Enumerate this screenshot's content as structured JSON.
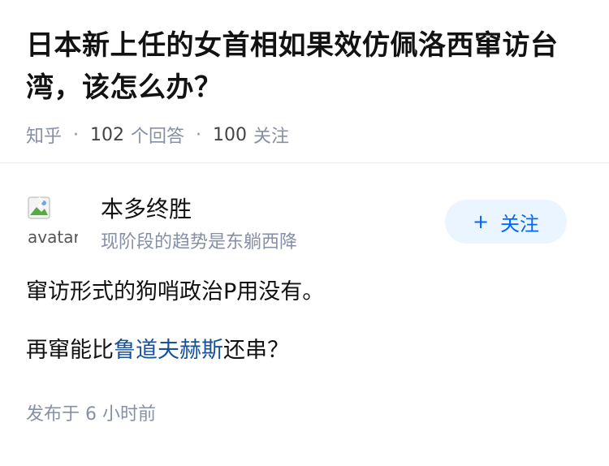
{
  "question": {
    "title": "日本新上任的女首相如果效仿佩洛西窜访台湾，该怎么办？",
    "source": "知乎",
    "separator": "·",
    "answer_count": "102",
    "answer_label": "个回答",
    "follower_count": "100",
    "follower_label": "关注"
  },
  "answer": {
    "avatar_alt": "avatar",
    "author_name": "本多终胜",
    "author_bio": "现阶段的趋势是东躺西降",
    "follow_button": {
      "icon": "plus-icon",
      "plus": "+",
      "label": "关注"
    },
    "paragraph1": "窜访形式的狗哨政治P用没有。",
    "paragraph2_before": "再窜能比",
    "paragraph2_link": "鲁道夫赫斯",
    "paragraph2_after": "还串？",
    "published": "发布于 6 小时前"
  },
  "colors": {
    "link": "#175199",
    "accent": "#0066ff",
    "follow_bg": "#ebf5ff",
    "meta": "#8590a6"
  }
}
